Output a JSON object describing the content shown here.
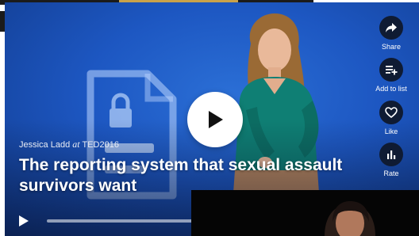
{
  "video": {
    "speaker": "Jessica Ladd",
    "at": "at",
    "event": "TED2016",
    "title": "The reporting system that sexual assault survivors want"
  },
  "actions": [
    {
      "label": "Share",
      "icon": "share-icon"
    },
    {
      "label": "Add to list",
      "icon": "add-to-list-icon"
    },
    {
      "label": "Like",
      "icon": "heart-icon"
    },
    {
      "label": "Rate",
      "icon": "bar-chart-icon"
    }
  ],
  "playback": {
    "progress": 0
  },
  "colors": {
    "stage_blue": "#1d57c2",
    "action_circle": "#0f1b33",
    "speaker_top": "#0f7f74"
  }
}
